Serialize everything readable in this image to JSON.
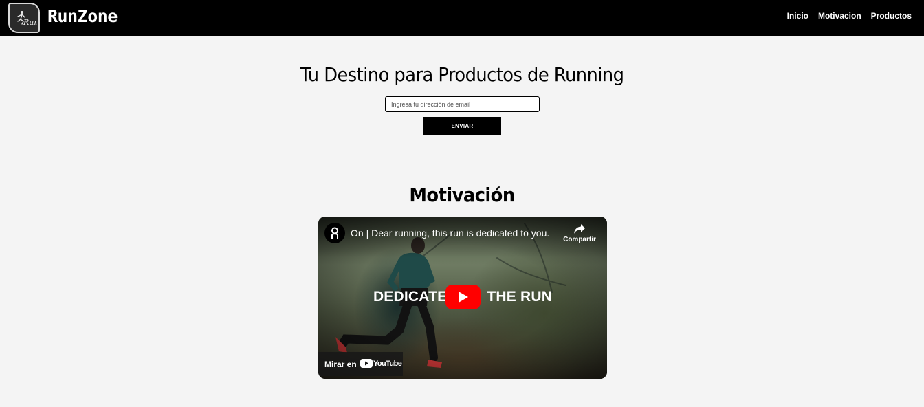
{
  "header": {
    "logo_icon": "runner-logo-icon",
    "logo_text": "Run",
    "brand": "RunZone",
    "nav": [
      {
        "label": "Inicio"
      },
      {
        "label": "Motivacion"
      },
      {
        "label": "Productos"
      }
    ]
  },
  "hero": {
    "title": "Tu Destino para Productos de Running",
    "email_placeholder": "Ingresa tu dirección de email",
    "email_value": "",
    "submit_label": "ENVIAR"
  },
  "motivation": {
    "title": "Motivación",
    "video": {
      "channel_icon": "on-logo-icon",
      "title": "On | Dear running, this run is dedicated to you.",
      "share_label": "Compartir",
      "overlay_left": "DEDICATE",
      "overlay_right": "THE RUN",
      "watch_on": "Mirar en",
      "youtube_word": "YouTube"
    }
  },
  "colors": {
    "nav_bg": "#000000",
    "page_bg": "#f4f4f4",
    "button_bg": "#000000",
    "play_red": "#ff0000"
  }
}
